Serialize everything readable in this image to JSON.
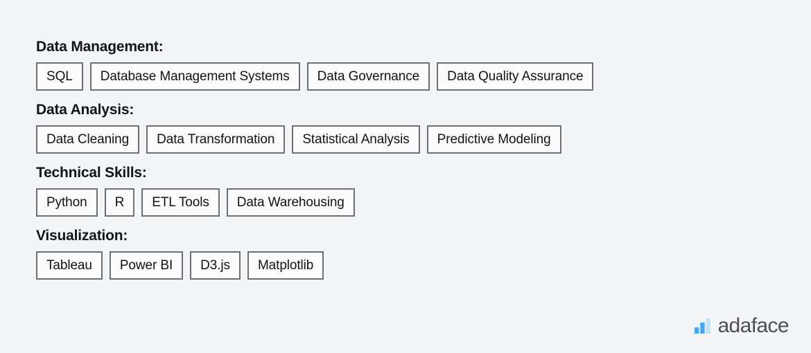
{
  "background_color": "#f4f5f6",
  "skill_groups": [
    {
      "heading": "Data Management:",
      "tags": [
        "SQL",
        "Database Management Systems",
        "Data Governance",
        "Data Quality Assurance"
      ]
    },
    {
      "heading": "Data Analysis:",
      "tags": [
        "Data Cleaning",
        "Data Transformation",
        "Statistical Analysis",
        "Predictive Modeling"
      ]
    },
    {
      "heading": "Technical Skills:",
      "tags": [
        "Python",
        "R",
        "ETL Tools",
        "Data Warehousing"
      ]
    },
    {
      "heading": "Visualization:",
      "tags": [
        "Tableau",
        "Power BI",
        "D3.js",
        "Matplotlib"
      ]
    }
  ],
  "brand": {
    "name": "adaface",
    "icon": "bar-chart-logo-icon",
    "text_color": "#4d4f53",
    "bar_colors": [
      "#3fa9f5",
      "#3fa9f5",
      "#bfe3f7"
    ]
  }
}
